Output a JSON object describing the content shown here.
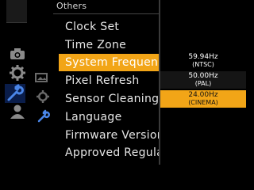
{
  "section_title": "Others",
  "menu": {
    "items": [
      {
        "label": "Clock Set"
      },
      {
        "label": "Time Zone"
      },
      {
        "label": "System Frequency"
      },
      {
        "label": "Pixel Refresh"
      },
      {
        "label": "Sensor Cleaning"
      },
      {
        "label": "Language"
      },
      {
        "label": "Firmware Version"
      },
      {
        "label": "Approved Regulations"
      }
    ],
    "selected_index": 2
  },
  "frequency_options": [
    {
      "hz": "59.94Hz",
      "system": "(NTSC)"
    },
    {
      "hz": "50.00Hz",
      "system": "(PAL)"
    },
    {
      "hz": "24.00Hz",
      "system": "(CINEMA)"
    }
  ],
  "selected_option_index": 2,
  "icons": [
    "camera-icon",
    "gear-icon",
    "wrench-icon",
    "person-icon",
    "photo-icon",
    "gear-small-icon",
    "wrench-small-icon"
  ],
  "colors": {
    "accent": "#f2a517",
    "background": "#000000",
    "text": "#e6e6e6"
  }
}
